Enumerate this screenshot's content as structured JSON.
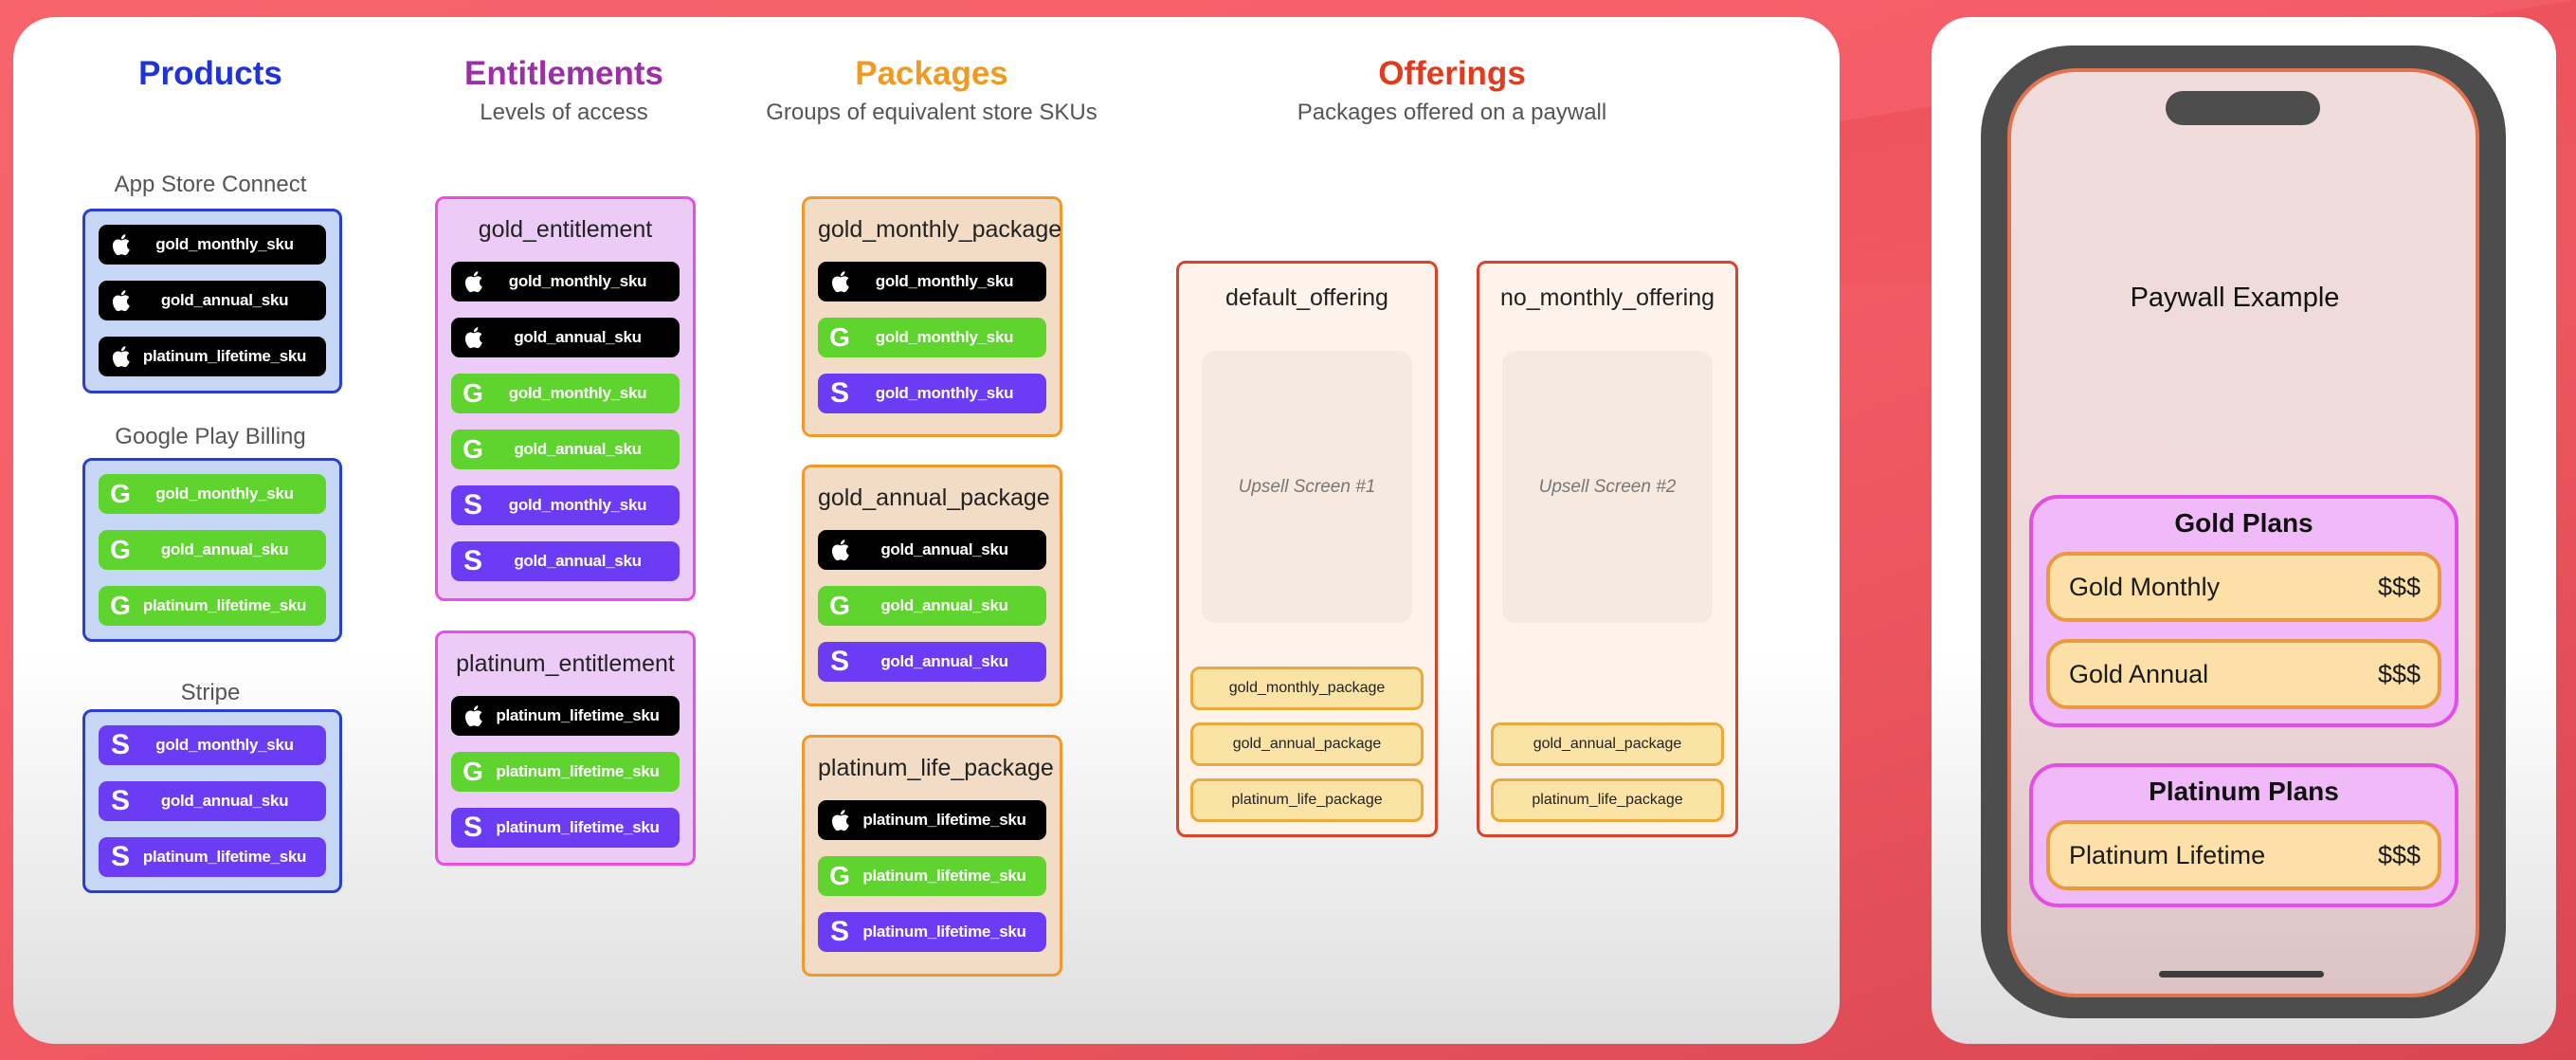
{
  "columns": {
    "products": {
      "title": "Products",
      "color": "#1f33d6"
    },
    "entitlements": {
      "title": "Entitlements",
      "subtitle": "Levels of access",
      "color": "#9b2fa6"
    },
    "packages": {
      "title": "Packages",
      "subtitle": "Groups of equivalent store SKUs",
      "color": "#f19a22"
    },
    "offerings": {
      "title": "Offerings",
      "subtitle": "Packages offered on a paywall",
      "color": "#e13b1e"
    }
  },
  "stores": [
    {
      "label": "App Store Connect",
      "skus": [
        {
          "store": "apple",
          "icon": "apple-icon",
          "label": "gold_monthly_sku"
        },
        {
          "store": "apple",
          "icon": "apple-icon",
          "label": "gold_annual_sku"
        },
        {
          "store": "apple",
          "icon": "apple-icon",
          "label": "platinum_lifetime_sku"
        }
      ]
    },
    {
      "label": "Google Play Billing",
      "skus": [
        {
          "store": "google",
          "icon": "google-icon",
          "label": "gold_monthly_sku"
        },
        {
          "store": "google",
          "icon": "google-icon",
          "label": "gold_annual_sku"
        },
        {
          "store": "google",
          "icon": "google-icon",
          "label": "platinum_lifetime_sku"
        }
      ]
    },
    {
      "label": "Stripe",
      "skus": [
        {
          "store": "stripe",
          "icon": "stripe-icon",
          "label": "gold_monthly_sku"
        },
        {
          "store": "stripe",
          "icon": "stripe-icon",
          "label": "gold_annual_sku"
        },
        {
          "store": "stripe",
          "icon": "stripe-icon",
          "label": "platinum_lifetime_sku"
        }
      ]
    }
  ],
  "entitlements": [
    {
      "name": "gold_entitlement",
      "skus": [
        {
          "store": "apple",
          "label": "gold_monthly_sku"
        },
        {
          "store": "apple",
          "label": "gold_annual_sku"
        },
        {
          "store": "google",
          "label": "gold_monthly_sku"
        },
        {
          "store": "google",
          "label": "gold_annual_sku"
        },
        {
          "store": "stripe",
          "label": "gold_monthly_sku"
        },
        {
          "store": "stripe",
          "label": "gold_annual_sku"
        }
      ]
    },
    {
      "name": "platinum_entitlement",
      "skus": [
        {
          "store": "apple",
          "label": "platinum_lifetime_sku"
        },
        {
          "store": "google",
          "label": "platinum_lifetime_sku"
        },
        {
          "store": "stripe",
          "label": "platinum_lifetime_sku"
        }
      ]
    }
  ],
  "packages": [
    {
      "name": "gold_monthly_package",
      "skus": [
        {
          "store": "apple",
          "label": "gold_monthly_sku"
        },
        {
          "store": "google",
          "label": "gold_monthly_sku"
        },
        {
          "store": "stripe",
          "label": "gold_monthly_sku"
        }
      ]
    },
    {
      "name": "gold_annual_package",
      "skus": [
        {
          "store": "apple",
          "label": "gold_annual_sku"
        },
        {
          "store": "google",
          "label": "gold_annual_sku"
        },
        {
          "store": "stripe",
          "label": "gold_annual_sku"
        }
      ]
    },
    {
      "name": "platinum_life_package",
      "skus": [
        {
          "store": "apple",
          "label": "platinum_lifetime_sku"
        },
        {
          "store": "google",
          "label": "platinum_lifetime_sku"
        },
        {
          "store": "stripe",
          "label": "platinum_lifetime_sku"
        }
      ]
    }
  ],
  "offerings": [
    {
      "name": "default_offering",
      "upsell": "Upsell Screen #1",
      "packages": [
        "gold_monthly_package",
        "gold_annual_package",
        "platinum_life_package"
      ]
    },
    {
      "name": "no_monthly_offering",
      "upsell": "Upsell Screen #2",
      "packages": [
        "gold_annual_package",
        "platinum_life_package"
      ]
    }
  ],
  "paywall": {
    "title": "Paywall Example",
    "groups": [
      {
        "title": "Gold Plans",
        "items": [
          {
            "name": "Gold Monthly",
            "price": "$$$"
          },
          {
            "name": "Gold Annual",
            "price": "$$$"
          }
        ]
      },
      {
        "title": "Platinum Plans",
        "items": [
          {
            "name": "Platinum Lifetime",
            "price": "$$$"
          }
        ]
      }
    ]
  }
}
